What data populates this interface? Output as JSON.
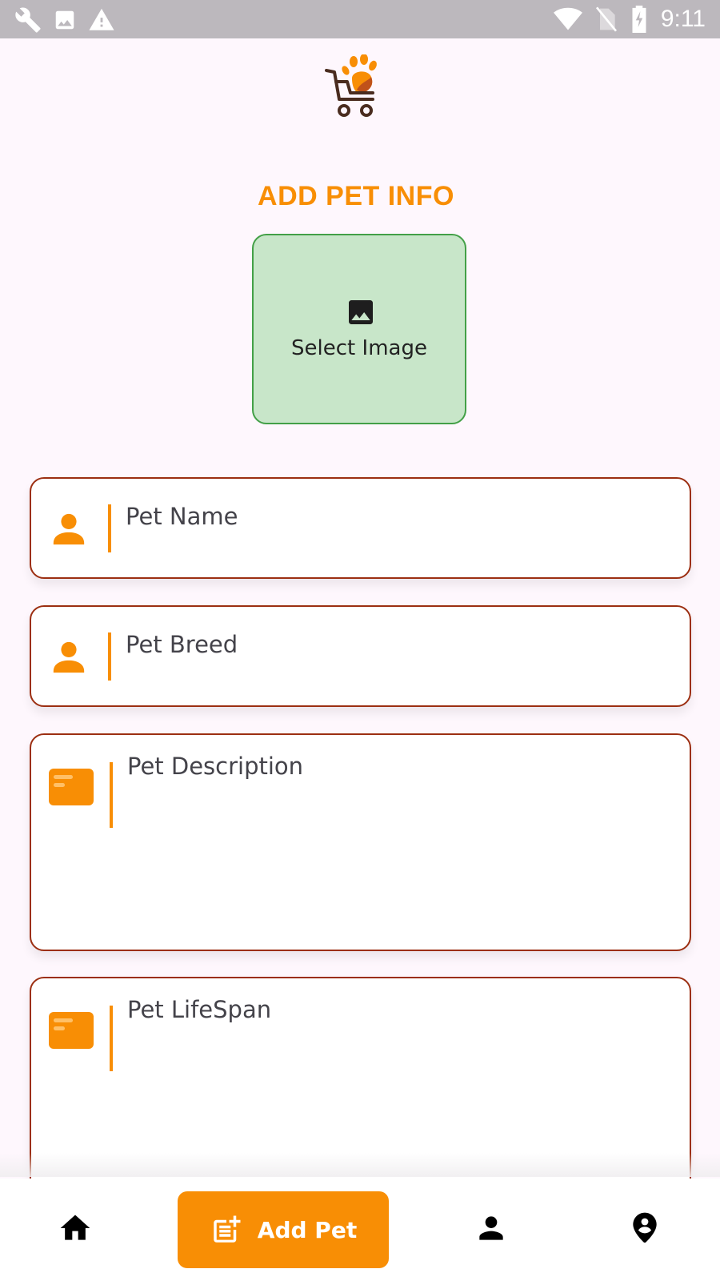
{
  "status_bar": {
    "time": "9:11",
    "left_icons": [
      "wrench-icon",
      "image-icon",
      "warning-icon"
    ],
    "right_icons": [
      "wifi-icon",
      "no-sim-icon",
      "battery-charging-icon"
    ]
  },
  "app": {
    "logo": "paw-cart-logo"
  },
  "page": {
    "title": "ADD PET INFO",
    "select_image_label": "Select Image"
  },
  "form": {
    "fields": [
      {
        "placeholder": "Pet Name",
        "icon": "person-icon"
      },
      {
        "placeholder": "Pet Breed",
        "icon": "person-icon"
      },
      {
        "placeholder": "Pet Description",
        "icon": "card-icon"
      },
      {
        "placeholder": "Pet LifeSpan",
        "icon": "card-icon"
      }
    ]
  },
  "bottom_nav": {
    "items": [
      {
        "icon": "home-icon"
      },
      {
        "icon": "post-add-icon",
        "label": "Add Pet",
        "active": true
      },
      {
        "icon": "person-icon"
      },
      {
        "icon": "location-person-icon"
      }
    ]
  },
  "colors": {
    "accent": "#f88e05",
    "field_border": "#9c2f12",
    "image_box_bg": "#c8e6c9",
    "image_box_border": "#43a047",
    "background": "#fef7fd",
    "status_bar": "#bcb8bd"
  }
}
